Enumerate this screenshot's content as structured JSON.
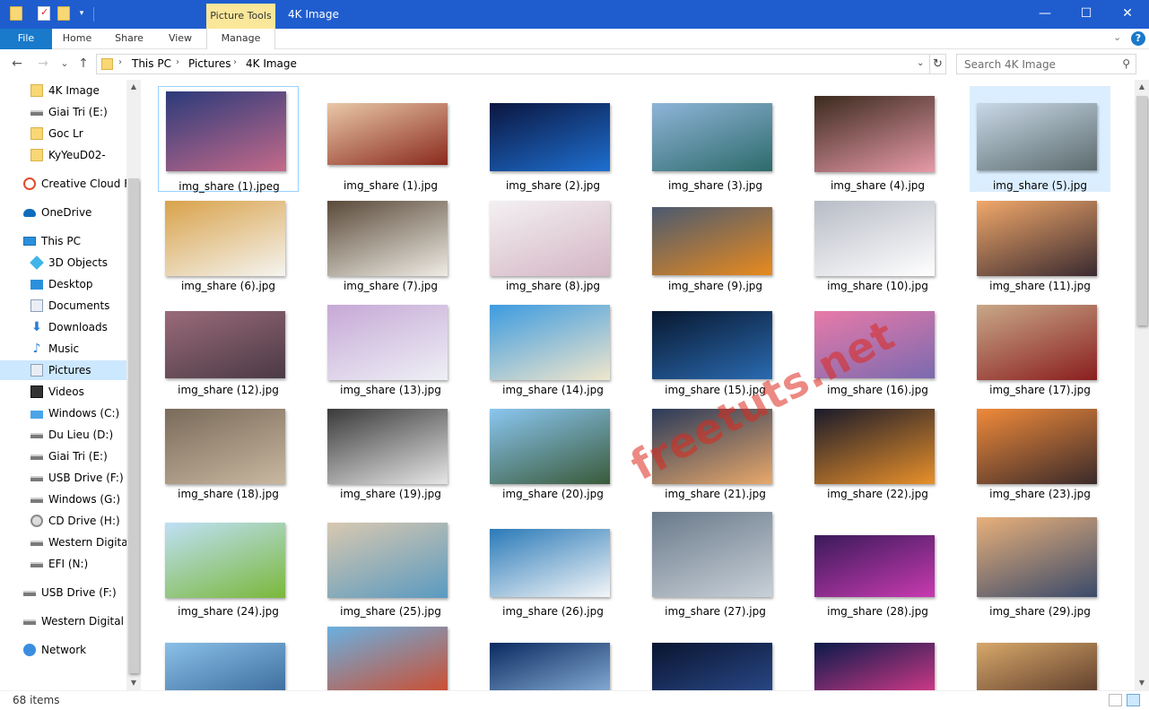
{
  "window": {
    "title": "4K Image",
    "contextual_tab": "Picture Tools",
    "controls": {
      "minimize": "—",
      "maximize": "☐",
      "close": "✕"
    }
  },
  "ribbon": {
    "tabs": [
      "File",
      "Home",
      "Share",
      "View",
      "Manage"
    ],
    "expand_icon": "chevron-down-icon",
    "help": "?"
  },
  "address": {
    "back": "←",
    "forward": "→",
    "recent": "⌄",
    "up": "↑",
    "crumbs": [
      "This PC",
      "Pictures",
      "4K Image"
    ],
    "search_placeholder": "Search 4K Image"
  },
  "nav": {
    "items": [
      {
        "label": "4K Image",
        "icon": "folder-icon",
        "indent": 1,
        "selected": false
      },
      {
        "label": "Giai Tri (E:)",
        "icon": "drive-icon",
        "indent": 1,
        "selected": false
      },
      {
        "label": "Goc Lr",
        "icon": "folder-icon",
        "indent": 1,
        "selected": false
      },
      {
        "label": "KyYeuD02-",
        "icon": "folder-icon",
        "indent": 1,
        "selected": false
      },
      {
        "label": "Creative Cloud Fil",
        "icon": "creative-cloud-icon",
        "indent": 0,
        "selected": false
      },
      {
        "label": "OneDrive",
        "icon": "onedrive-icon",
        "indent": 0,
        "selected": false
      },
      {
        "label": "This PC",
        "icon": "pc-icon",
        "indent": 0,
        "selected": false
      },
      {
        "label": "3D Objects",
        "icon": "3d-objects-icon",
        "indent": 1,
        "selected": false
      },
      {
        "label": "Desktop",
        "icon": "desktop-icon",
        "indent": 1,
        "selected": false
      },
      {
        "label": "Documents",
        "icon": "documents-icon",
        "indent": 1,
        "selected": false
      },
      {
        "label": "Downloads",
        "icon": "downloads-icon",
        "indent": 1,
        "selected": false
      },
      {
        "label": "Music",
        "icon": "music-icon",
        "indent": 1,
        "selected": false
      },
      {
        "label": "Pictures",
        "icon": "pictures-icon",
        "indent": 1,
        "selected": true
      },
      {
        "label": "Videos",
        "icon": "videos-icon",
        "indent": 1,
        "selected": false
      },
      {
        "label": "Windows (C:)",
        "icon": "windows-drive-icon",
        "indent": 1,
        "selected": false
      },
      {
        "label": "Du Lieu (D:)",
        "icon": "drive-icon",
        "indent": 1,
        "selected": false
      },
      {
        "label": "Giai Tri (E:)",
        "icon": "drive-icon",
        "indent": 1,
        "selected": false
      },
      {
        "label": "USB Drive (F:)",
        "icon": "drive-icon",
        "indent": 1,
        "selected": false
      },
      {
        "label": "Windows (G:)",
        "icon": "drive-icon",
        "indent": 1,
        "selected": false
      },
      {
        "label": "CD Drive (H:)",
        "icon": "cd-drive-icon",
        "indent": 1,
        "selected": false
      },
      {
        "label": "Western Digital P",
        "icon": "drive-icon",
        "indent": 1,
        "selected": false
      },
      {
        "label": "EFI (N:)",
        "icon": "drive-icon",
        "indent": 1,
        "selected": false
      },
      {
        "label": "USB Drive (F:)",
        "icon": "drive-icon",
        "indent": 0,
        "selected": false
      },
      {
        "label": "Western Digital Pa",
        "icon": "drive-icon",
        "indent": 0,
        "selected": false
      },
      {
        "label": "Network",
        "icon": "network-icon",
        "indent": 0,
        "selected": false
      }
    ]
  },
  "files": [
    {
      "name": "img_share (1).jpeg",
      "colors": [
        "#2b3a7a",
        "#c46a8a"
      ],
      "state": "focus"
    },
    {
      "name": "img_share (1).jpg",
      "colors": [
        "#e9c8a8",
        "#8a2a1e"
      ],
      "state": ""
    },
    {
      "name": "img_share (2).jpg",
      "colors": [
        "#0b1640",
        "#1e6fd0"
      ],
      "state": ""
    },
    {
      "name": "img_share (3).jpg",
      "colors": [
        "#8fb4d8",
        "#2d6b6b"
      ],
      "state": ""
    },
    {
      "name": "img_share (4).jpg",
      "colors": [
        "#3b2a1e",
        "#e79aa8"
      ],
      "state": ""
    },
    {
      "name": "img_share (5).jpg",
      "colors": [
        "#c9d8e6",
        "#5b6b6e"
      ],
      "state": "selected"
    },
    {
      "name": "img_share (6).jpg",
      "colors": [
        "#d9a24a",
        "#f4f4f0"
      ],
      "state": ""
    },
    {
      "name": "img_share (7).jpg",
      "colors": [
        "#5a4a3a",
        "#efece4"
      ],
      "state": ""
    },
    {
      "name": "img_share (8).jpg",
      "colors": [
        "#f3f0f2",
        "#d4b6c4"
      ],
      "state": ""
    },
    {
      "name": "img_share (9).jpg",
      "colors": [
        "#4b5a70",
        "#e88a1e"
      ],
      "state": ""
    },
    {
      "name": "img_share (10).jpg",
      "colors": [
        "#b8bcc6",
        "#ffffff"
      ],
      "state": ""
    },
    {
      "name": "img_share (11).jpg",
      "colors": [
        "#f1a86a",
        "#3a2a30"
      ],
      "state": ""
    },
    {
      "name": "img_share (12).jpg",
      "colors": [
        "#9a6a7a",
        "#4a3a44"
      ],
      "state": ""
    },
    {
      "name": "img_share (13).jpg",
      "colors": [
        "#c6a8d6",
        "#eef0f6"
      ],
      "state": ""
    },
    {
      "name": "img_share (14).jpg",
      "colors": [
        "#3c9be0",
        "#f0e6cc"
      ],
      "state": ""
    },
    {
      "name": "img_share (15).jpg",
      "colors": [
        "#081830",
        "#2a6ab0"
      ],
      "state": ""
    },
    {
      "name": "img_share (16).jpg",
      "colors": [
        "#e87aa8",
        "#7a6ab0"
      ],
      "state": ""
    },
    {
      "name": "img_share (17).jpg",
      "colors": [
        "#c8a888",
        "#8a1e1e"
      ],
      "state": ""
    },
    {
      "name": "img_share (18).jpg",
      "colors": [
        "#7a6a5a",
        "#c8b8a0"
      ],
      "state": ""
    },
    {
      "name": "img_share (19).jpg",
      "colors": [
        "#3a3a3a",
        "#e6e6e6"
      ],
      "state": ""
    },
    {
      "name": "img_share (20).jpg",
      "colors": [
        "#8ac6f0",
        "#3a5a3a"
      ],
      "state": ""
    },
    {
      "name": "img_share (21).jpg",
      "colors": [
        "#2a3a5a",
        "#e8a86a"
      ],
      "state": ""
    },
    {
      "name": "img_share (22).jpg",
      "colors": [
        "#1a1a2a",
        "#e8902a"
      ],
      "state": ""
    },
    {
      "name": "img_share (23).jpg",
      "colors": [
        "#f08a3a",
        "#3a2a2a"
      ],
      "state": ""
    },
    {
      "name": "img_share (24).jpg",
      "colors": [
        "#bfe0f6",
        "#7ab83a"
      ],
      "state": ""
    },
    {
      "name": "img_share (25).jpg",
      "colors": [
        "#d8c8b0",
        "#5a9ac0"
      ],
      "state": ""
    },
    {
      "name": "img_share (26).jpg",
      "colors": [
        "#2a7ab8",
        "#f4f6f8"
      ],
      "state": ""
    },
    {
      "name": "img_share (27).jpg",
      "colors": [
        "#6a7a8a",
        "#c8d0d8"
      ],
      "state": ""
    },
    {
      "name": "img_share (28).jpg",
      "colors": [
        "#3a1a5a",
        "#c83ab0"
      ],
      "state": ""
    },
    {
      "name": "img_share (29).jpg",
      "colors": [
        "#e8b07a",
        "#3a4a6a"
      ],
      "state": ""
    },
    {
      "name": "",
      "colors": [
        "#8ac0e8",
        "#3a6a9a"
      ],
      "state": ""
    },
    {
      "name": "",
      "colors": [
        "#6ab0e0",
        "#d04a2a"
      ],
      "state": ""
    },
    {
      "name": "",
      "colors": [
        "#0a2a60",
        "#8ab0d8"
      ],
      "state": ""
    },
    {
      "name": "",
      "colors": [
        "#0a1430",
        "#2a4a8a"
      ],
      "state": ""
    },
    {
      "name": "",
      "colors": [
        "#0a1a4a",
        "#d83a8a"
      ],
      "state": ""
    },
    {
      "name": "",
      "colors": [
        "#d8a86a",
        "#5a3a2a"
      ],
      "state": ""
    }
  ],
  "watermark": "freetuts.net",
  "status": {
    "item_count": "68 items"
  },
  "colors": {
    "titlebar": "#1f5dcf",
    "file_tab": "#1979ca",
    "selection": "#cce8ff"
  }
}
